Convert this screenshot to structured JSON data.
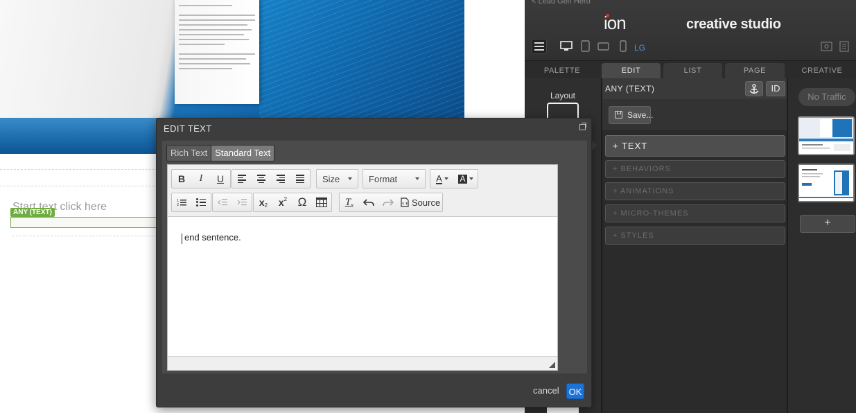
{
  "studio": {
    "back_link": "< Lead Gen Hero",
    "logo": "ion",
    "product_name": "creative studio",
    "device_size": "LG",
    "tabs": [
      "PALETTE",
      "EDIT",
      "LIST",
      "PAGE",
      "CREATIVE"
    ]
  },
  "layout_panel": {
    "label": "Layout"
  },
  "edit_panel": {
    "title": "ANY (TEXT)",
    "id_button": "ID",
    "save_button": "Save...",
    "sections": [
      "+ TEXT",
      "+ BEHAVIORS",
      "+ ANIMATIONS",
      "+ MICRO-THEMES",
      "+ STYLES"
    ]
  },
  "creative_panel": {
    "traffic_status": "No Traffic",
    "add_button": "+"
  },
  "canvas": {
    "placeholder_text": "Start text click here",
    "element_badge": "ANY (TEXT)"
  },
  "dialog": {
    "title": "EDIT TEXT",
    "mode_tabs": [
      "Rich Text",
      "Standard Text"
    ],
    "toolbar": {
      "size_label": "Size",
      "format_label": "Format",
      "source_label": "Source"
    },
    "editor_content": "end sentence.",
    "cancel_label": "cancel",
    "ok_label": "OK"
  },
  "colors": {
    "accent": "#1c72d6",
    "badge": "#6fae3e",
    "logo_dot": "#e0322c"
  }
}
